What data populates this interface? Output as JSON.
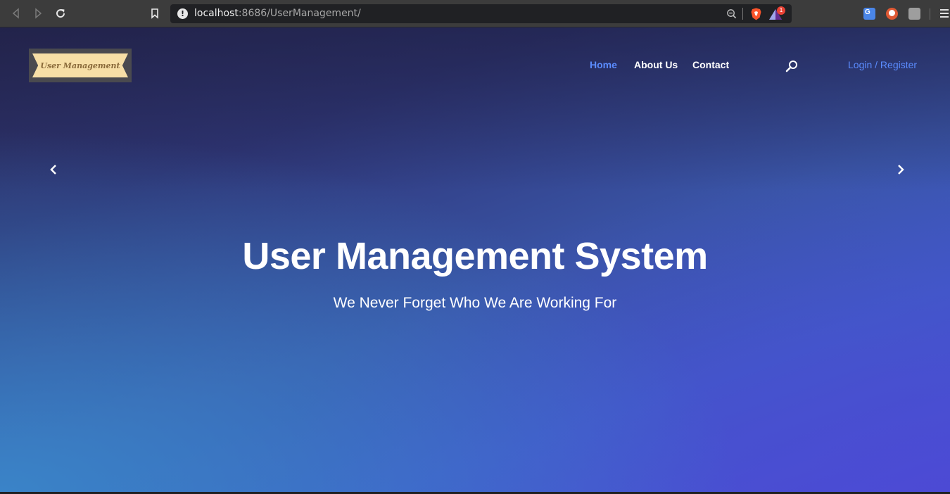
{
  "browser": {
    "url_host": "localhost",
    "url_rest": ":8686/UserManagement/",
    "info_icon": "info-icon",
    "rewards_badge": "1",
    "icons": [
      "back-icon",
      "forward-icon",
      "reload-icon",
      "bookmark-icon",
      "zoom-icon",
      "brave-shield-icon",
      "brave-rewards-icon",
      "google-translate-icon",
      "duckduckgo-icon",
      "extension-icon",
      "menu-icon"
    ]
  },
  "header": {
    "logo_text": "User Management",
    "nav": {
      "home": "Home",
      "about": "About Us",
      "contact": "Contact"
    },
    "login_label": "Login / Register"
  },
  "hero": {
    "title": "User Management System",
    "subtitle": "We Never Forget Who We Are Working For"
  },
  "colors": {
    "accent": "#5b8cff",
    "logo_bg": "#f7dfa6",
    "logo_text": "#8a6a3a",
    "gradient_dark": "#2a2c5c",
    "gradient_blue": "#3a8ccd",
    "gradient_violet": "#4a4fd6"
  }
}
